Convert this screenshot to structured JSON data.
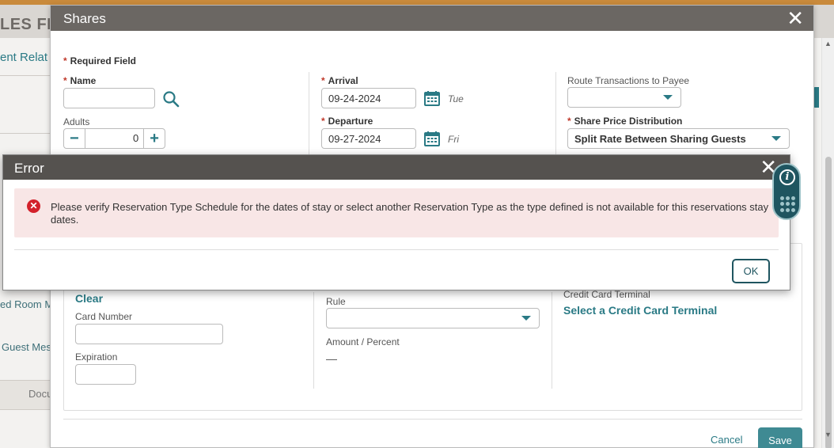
{
  "background": {
    "title": "LES FIRS",
    "relat": "ent Relat",
    "side_items": [
      "ed Room M",
      "Guest Mes"
    ],
    "docu": "Docu"
  },
  "shares": {
    "title": "Shares",
    "required_note": "Required Field",
    "name_label": "Name",
    "name_value": "",
    "adults_label": "Adults",
    "adults_value": "0",
    "arrival_label": "Arrival",
    "arrival_value": "09-24-2024",
    "arrival_dow": "Tue",
    "departure_label": "Departure",
    "departure_value": "09-27-2024",
    "departure_dow": "Fri",
    "route_label": "Route Transactions to Payee",
    "route_value": "",
    "distribution_label": "Share Price Distribution",
    "distribution_value": "Split Rate Between Sharing Guests",
    "clear_link": "Clear",
    "card_number_label": "Card Number",
    "expiration_label": "Expiration",
    "rule_label": "Rule",
    "amount_label": "Amount / Percent",
    "amount_value": "—",
    "cc_terminal_label": "Credit Card Terminal",
    "cc_terminal_link": "Select a Credit Card Terminal",
    "cancel_label": "Cancel",
    "save_label": "Save"
  },
  "error": {
    "title": "Error",
    "message": "Please verify Reservation Type Schedule for the dates of stay or select another Reservation Type as the type defined is not available for this reservations stay dates.",
    "ok_label": "OK"
  },
  "colors": {
    "accent": "#2a7a85",
    "error_bg": "#f8e6e6",
    "error_icon": "#d3212b",
    "header": "#6b6763"
  },
  "icons": [
    "close-icon",
    "search-icon",
    "calendar-icon",
    "error-icon",
    "info-icon",
    "grid-dots-icon",
    "chevron-down-icon"
  ]
}
